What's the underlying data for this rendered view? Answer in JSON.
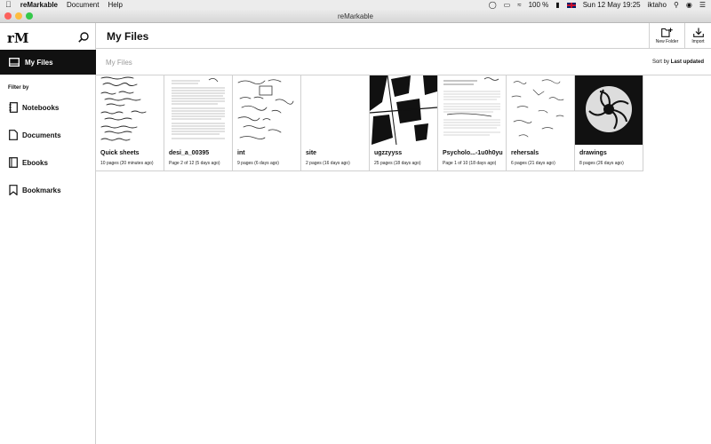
{
  "menubar": {
    "app_name": "reMarkable",
    "items": [
      "Document",
      "Help"
    ],
    "battery": "100 %",
    "datetime": "Sun 12 May  19:25",
    "user": "iktaho"
  },
  "window": {
    "title": "reMarkable"
  },
  "sidebar": {
    "logo": "rM",
    "my_files": "My Files",
    "filter_label": "Filter by",
    "filters": [
      "Notebooks",
      "Documents",
      "Ebooks",
      "Bookmarks"
    ]
  },
  "header": {
    "title": "My Files",
    "new_folder": "New Folder",
    "import": "Import"
  },
  "subbar": {
    "breadcrumb": "My Files",
    "sort_prefix": "Sort by",
    "sort_value": "Last updated"
  },
  "files": [
    {
      "name": "Quick sheets",
      "meta": "10 pages (20 minutes ago)"
    },
    {
      "name": "desi_a_00395",
      "meta": "Page 2 of 12 (5 days ago)"
    },
    {
      "name": "int",
      "meta": "9 pages (6 days ago)"
    },
    {
      "name": "site",
      "meta": "2 pages (16 days ago)"
    },
    {
      "name": "ugzzyyss",
      "meta": "25 pages (18 days ago)"
    },
    {
      "name": "Psycholo...-1u0h0yu",
      "meta": "Page 1 of 10 (18 days ago)"
    },
    {
      "name": "rehersals",
      "meta": "6 pages (21 days ago)"
    },
    {
      "name": "drawings",
      "meta": "8 pages (26 days ago)"
    }
  ],
  "colors": {
    "close": "#fc605c",
    "minimize": "#fdbc40",
    "zoom": "#34c84a",
    "active_nav": "#111111"
  }
}
